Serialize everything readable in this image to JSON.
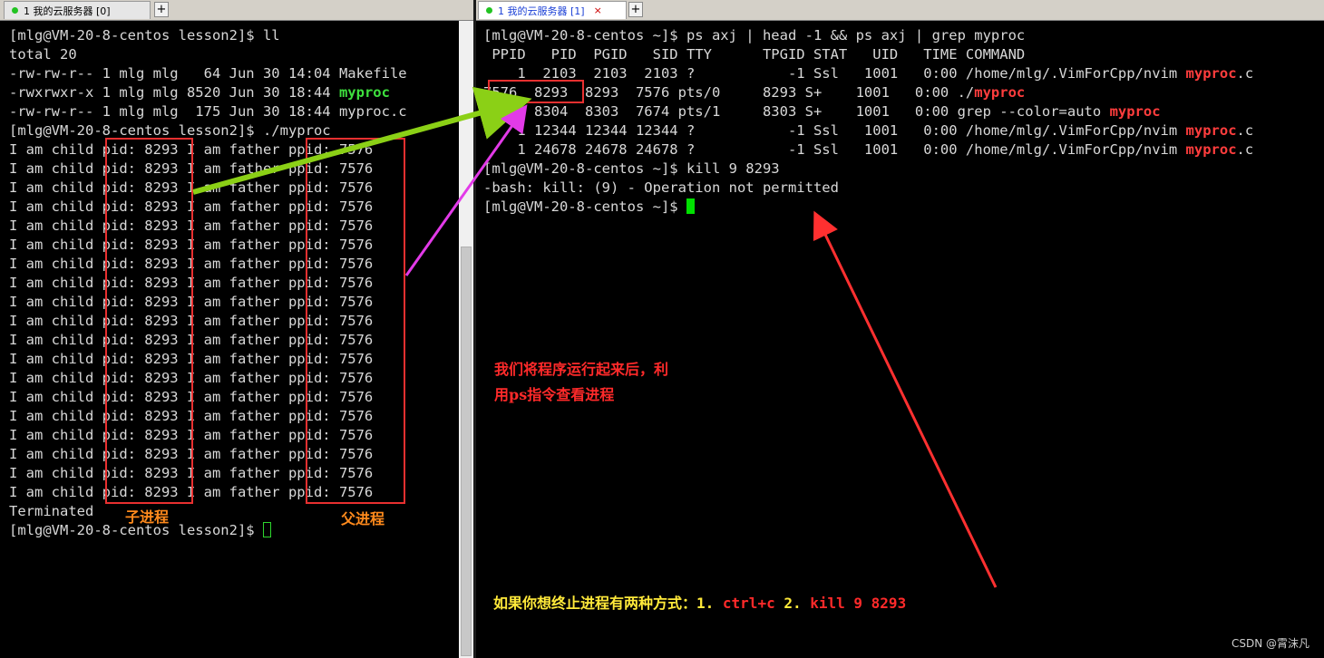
{
  "left_tab": {
    "title": "1 我的云服务器 [0]",
    "close": "×",
    "add": "+"
  },
  "right_tab": {
    "title": "1 我的云服务器 [1]",
    "close": "×",
    "add": "+"
  },
  "left_terminal": {
    "prompt_ll": "[mlg@VM-20-8-centos lesson2]$ ll",
    "total": "total 20",
    "files": [
      {
        "meta": "-rw-rw-r-- 1 mlg mlg   64 Jun 30 14:04 ",
        "name": "Makefile",
        "executable": false
      },
      {
        "meta": "-rwxrwxr-x 1 mlg mlg 8520 Jun 30 18:44 ",
        "name": "myproc",
        "executable": true
      },
      {
        "meta": "-rw-rw-r-- 1 mlg mlg  175 Jun 30 18:44 ",
        "name": "myproc.c",
        "executable": false
      }
    ],
    "prompt_run": "[mlg@VM-20-8-centos lesson2]$ ./myproc",
    "output_line": "I am child pid: 8293 I am father ppid: 7576",
    "output_count": 19,
    "terminated": "Terminated",
    "prompt_final": "[mlg@VM-20-8-centos lesson2]$ "
  },
  "right_terminal": {
    "command": "[mlg@VM-20-8-centos ~]$ ps axj | head -1 && ps axj | grep myproc",
    "header": " PPID   PID  PGID   SID TTY      TPGID STAT   UID   TIME COMMAND",
    "rows": [
      {
        "text": "    1  2103  2103  2103 ?           -1 Ssl   1001   0:00 /home/mlg/.VimForCpp/nvim ",
        "hl": "myproc",
        "rest": ".c"
      },
      {
        "text": "7576  8293  8293  7576 pts/0     8293 S+    1001   0:00 ./",
        "hl": "myproc",
        "rest": ""
      },
      {
        "text": "7674  8304  8303  7674 pts/1     8303 S+    1001   0:00 grep --color=auto ",
        "hl": "myproc",
        "rest": ""
      },
      {
        "text": "    1 12344 12344 12344 ?           -1 Ssl   1001   0:00 /home/mlg/.VimForCpp/nvim ",
        "hl": "myproc",
        "rest": ".c"
      },
      {
        "text": "    1 24678 24678 24678 ?           -1 Ssl   1001   0:00 /home/mlg/.VimForCpp/nvim ",
        "hl": "myproc",
        "rest": ".c"
      }
    ],
    "kill_cmd": "[mlg@VM-20-8-centos ~]$ kill 9 8293",
    "kill_error": "-bash: kill: (9) - Operation not permitted",
    "prompt_final": "[mlg@VM-20-8-centos ~]$ "
  },
  "annotations": {
    "child_label": "子进程",
    "father_label": "父进程",
    "ps_note_line1": "我们将程序运行起来后，利",
    "ps_note_line2": "用ps指令查看进程",
    "terminate_text": "如果你想终止进程有两种方式：1. ",
    "terminate_opt1": "ctrl+c",
    "terminate_mid": " 2. ",
    "terminate_opt2": "kill 9 8293"
  },
  "watermark": "CSDN @霄沫凡",
  "colors": {
    "terminal_bg": "#000000",
    "text": "#d8d8d8",
    "executable_green": "#3ee03e",
    "grep_highlight": "#ff3d3d",
    "box_red": "#e83030",
    "label_orange": "#ff8a1c",
    "note_yellow": "#ffe93a",
    "arrow_green": "#8bd016",
    "arrow_magenta": "#e23ae8",
    "arrow_red": "#ff3030"
  }
}
